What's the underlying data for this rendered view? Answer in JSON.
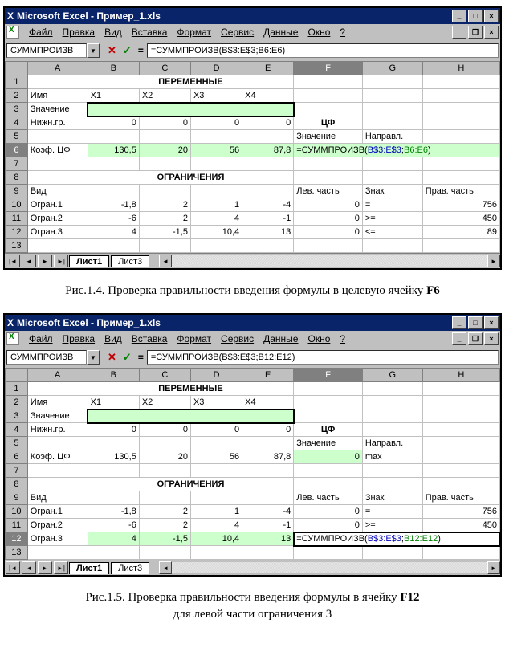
{
  "window_title": "Microsoft Excel - Пример_1.xls",
  "menu": {
    "file": "Файл",
    "edit": "Правка",
    "view": "Вид",
    "insert": "Вставка",
    "format": "Формат",
    "service": "Сервис",
    "data": "Данные",
    "window": "Окно",
    "help": "?"
  },
  "sheets": {
    "s1": "Лист1",
    "s3": "Лист3"
  },
  "nav": {
    "first": "|◄",
    "prev": "◄",
    "next": "►",
    "last": "►|",
    "left": "◄",
    "right": "►",
    "dd": "▼"
  },
  "winbtns": {
    "min": "_",
    "max": "□",
    "close": "×",
    "restore": "❐"
  },
  "cols": {
    "A": "A",
    "B": "B",
    "C": "C",
    "D": "D",
    "E": "E",
    "F": "F",
    "G": "G",
    "H": "H"
  },
  "top": {
    "namebox": "СУММПРОИЗВ",
    "formula": "=СУММПРОИЗВ(B$3:E$3;B6:E6)",
    "formula_parts": {
      "pre": "=СУММПРОИЗВ(",
      "r1": "B$3:E$3",
      "sep": ";",
      "r2": "B6:E6",
      "post": ")"
    },
    "hdrs": {
      "vars": "ПЕРЕМЕННЫЕ",
      "cf": "ЦФ",
      "constr": "ОГРАНИЧЕНИЯ"
    },
    "labels": {
      "name": "Имя",
      "value": "Значение",
      "lower": "Нижн.гр.",
      "coef": "Коэф. ЦФ",
      "znach": "Значение",
      "napr": "Направл.",
      "vid": "Вид",
      "lev": "Лев. часть",
      "znak": "Знак",
      "prav": "Прав. часть"
    },
    "vars": {
      "x1": "X1",
      "x2": "X2",
      "x3": "X3",
      "x4": "X4"
    },
    "lower": {
      "b": "0",
      "c": "0",
      "d": "0",
      "e": "0"
    },
    "coef": {
      "b": "130,5",
      "c": "20",
      "d": "56",
      "e": "87,8"
    },
    "constraints": [
      {
        "name": "Огран.1",
        "b": "-1,8",
        "c": "2",
        "d": "1",
        "e": "-4",
        "lev": "0",
        "sign": "=",
        "right": "756"
      },
      {
        "name": "Огран.2",
        "b": "-6",
        "c": "2",
        "d": "4",
        "e": "-1",
        "lev": "0",
        "sign": ">=",
        "right": "450"
      },
      {
        "name": "Огран.3",
        "b": "4",
        "c": "-1,5",
        "d": "10,4",
        "e": "13",
        "lev": "0",
        "sign": "<=",
        "right": "89"
      }
    ]
  },
  "bottom": {
    "namebox": "СУММПРОИЗВ",
    "formula": "=СУММПРОИЗВ(B$3:E$3;B12:E12)",
    "formula_parts": {
      "pre": "=СУММПРОИЗВ(",
      "r1": "B$3:E$3",
      "sep": ";",
      "r2": "B12:E12",
      "post": ")"
    },
    "hdrs": {
      "vars": "ПЕРЕМЕННЫЕ",
      "cf": "ЦФ",
      "constr": "ОГРАНИЧЕНИЯ"
    },
    "labels": {
      "name": "Имя",
      "value": "Значение",
      "lower": "Нижн.гр.",
      "coef": "Коэф. ЦФ",
      "znach": "Значение",
      "napr": "Направл.",
      "vid": "Вид",
      "lev": "Лев. часть",
      "znak": "Знак",
      "prav": "Прав. часть",
      "max": "max"
    },
    "vars": {
      "x1": "X1",
      "x2": "X2",
      "x3": "X3",
      "x4": "X4"
    },
    "lower": {
      "b": "0",
      "c": "0",
      "d": "0",
      "e": "0"
    },
    "coef": {
      "b": "130,5",
      "c": "20",
      "d": "56",
      "e": "87,8",
      "f": "0"
    },
    "constraints": [
      {
        "name": "Огран.1",
        "b": "-1,8",
        "c": "2",
        "d": "1",
        "e": "-4",
        "lev": "0",
        "sign": "=",
        "right": "756"
      },
      {
        "name": "Огран.2",
        "b": "-6",
        "c": "2",
        "d": "4",
        "e": "-1",
        "lev": "0",
        "sign": ">=",
        "right": "450"
      },
      {
        "name": "Огран.3",
        "b": "4",
        "c": "-1,5",
        "d": "10,4",
        "e": "13"
      }
    ]
  },
  "captions": {
    "c1_pre": "Рис.1.4. Проверка правильности введения формулы в целевую ячейку ",
    "c1_b": "F6",
    "c2_pre": "Рис.1.5. Проверка правильности введения формулы в ячейку ",
    "c2_b": "F12",
    "c2_line2": "для левой части ограничения 3"
  },
  "fx": {
    "x": "✕",
    "v": "✓",
    "eq": "="
  }
}
